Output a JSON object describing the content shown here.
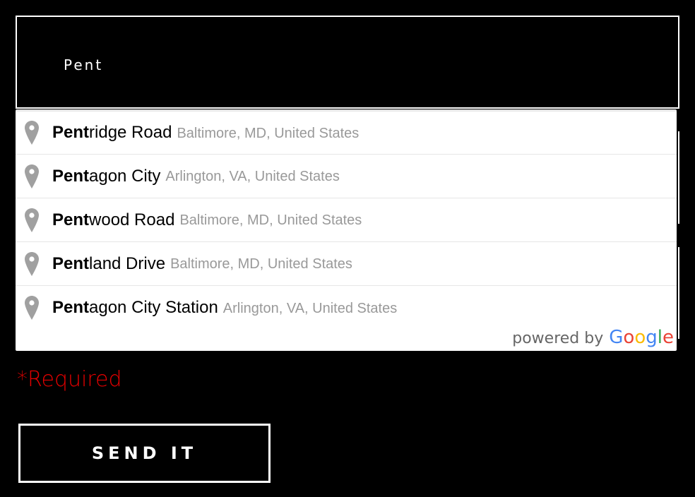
{
  "address_input": {
    "value": "Pent"
  },
  "suggestions": [
    {
      "match": "Pent",
      "rest": "ridge Road",
      "secondary": "Baltimore, MD, United States"
    },
    {
      "match": "Pent",
      "rest": "agon City",
      "secondary": "Arlington, VA, United States"
    },
    {
      "match": "Pent",
      "rest": "wood Road",
      "secondary": "Baltimore, MD, United States"
    },
    {
      "match": "Pent",
      "rest": "land Drive",
      "secondary": "Baltimore, MD, United States"
    },
    {
      "match": "Pent",
      "rest": "agon City Station",
      "secondary": "Arlington, VA, United States"
    }
  ],
  "attribution": {
    "label": "powered by",
    "brand": "Google"
  },
  "required_note": "*Required",
  "submit_label": "SEND IT",
  "colors": {
    "background": "#000000",
    "required": "#e60000",
    "secondary_text": "#999999",
    "pin_icon": "#a0a0a0"
  },
  "icons": {
    "suggestion_icon": "map-pin-icon"
  }
}
